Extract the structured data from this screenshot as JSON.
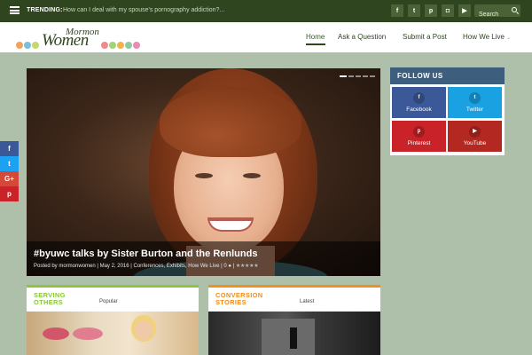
{
  "topbar": {
    "trending_label": "TRENDING:",
    "trending_text": "How can I deal with my spouse's pornography addiction?...",
    "socials": [
      {
        "icon": "facebook-icon",
        "glyph": "f"
      },
      {
        "icon": "twitter-icon",
        "glyph": "t"
      },
      {
        "icon": "pinterest-icon",
        "glyph": "p"
      },
      {
        "icon": "instagram-icon",
        "glyph": "◘"
      },
      {
        "icon": "youtube-icon",
        "glyph": "▶"
      }
    ],
    "search_placeholder": "Search"
  },
  "header": {
    "logo_top": "Mormon",
    "logo_main": "Women",
    "nav": [
      "Home",
      "Ask a Question",
      "Submit a Post",
      "How We Live"
    ]
  },
  "share": [
    {
      "glyph": "f",
      "color": "#3b5998"
    },
    {
      "glyph": "t",
      "color": "#1da1f2"
    },
    {
      "glyph": "G+",
      "color": "#d34836"
    },
    {
      "glyph": "p",
      "color": "#c92228"
    }
  ],
  "hero": {
    "title": "#byuwc talks by Sister Burton and the Renlunds",
    "meta": "Posted by mormonwomen | May 2, 2016 | Conferences, Exhibits, How We Live | 0",
    "rating": "★★★★★"
  },
  "follow": {
    "title": "FOLLOW US",
    "tiles": [
      {
        "label": "Facebook",
        "glyph": "f",
        "color": "#3b5998"
      },
      {
        "label": "Twitter",
        "glyph": "t",
        "color": "#1aa1e1"
      },
      {
        "label": "Pinterest",
        "glyph": "p",
        "color": "#c92228"
      },
      {
        "label": "YouTube",
        "glyph": "▶",
        "color": "#b32821"
      }
    ]
  },
  "boxes": [
    {
      "cat_line1": "SERVING",
      "cat_line2": "OTHERS",
      "tab": "Popular",
      "accent": "#8cc63e",
      "cat_color": "#8cc63e"
    },
    {
      "cat_line1": "CONVERSION",
      "cat_line2": "STORIES",
      "tab": "Latest",
      "accent": "#ef8f1d",
      "cat_color": "#ef8f1d"
    }
  ],
  "colors": {
    "topbar": "#2f4520",
    "background": "#aebfaa",
    "follow_header": "#3d5e7c"
  }
}
